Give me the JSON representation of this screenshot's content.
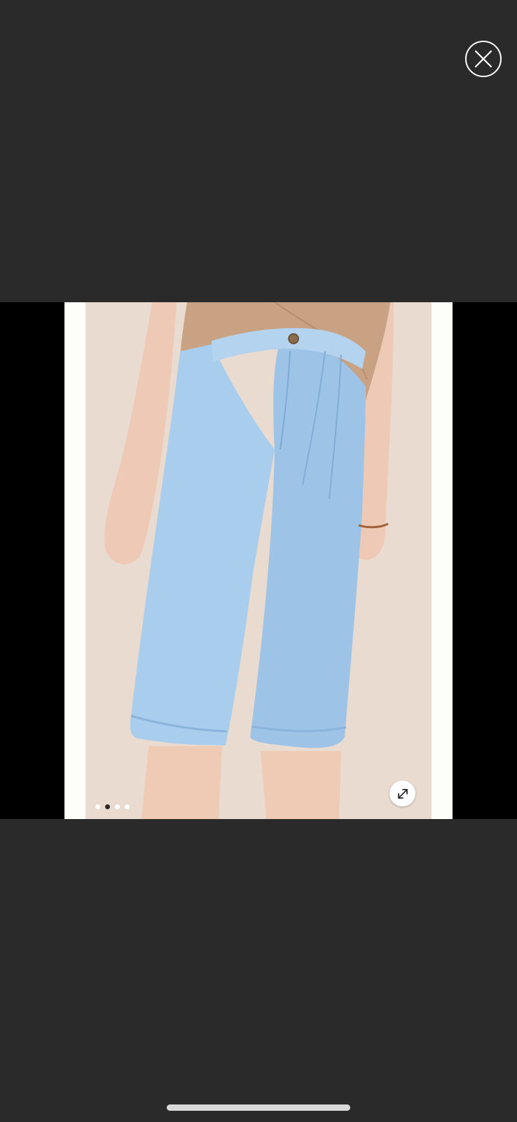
{
  "viewer": {
    "close_icon": "close-icon",
    "expand_icon": "expand-arrows-icon",
    "image_subject": "light-wash-denim-culottes",
    "pager": {
      "total": 4,
      "current": 2
    },
    "colors": {
      "backdrop": "#2a2a2a",
      "stage": "#000000",
      "photo_bg": "#fdfdfa",
      "denim": "#a9cdec",
      "top": "#c8a182",
      "skin": "#efcdb9"
    }
  }
}
